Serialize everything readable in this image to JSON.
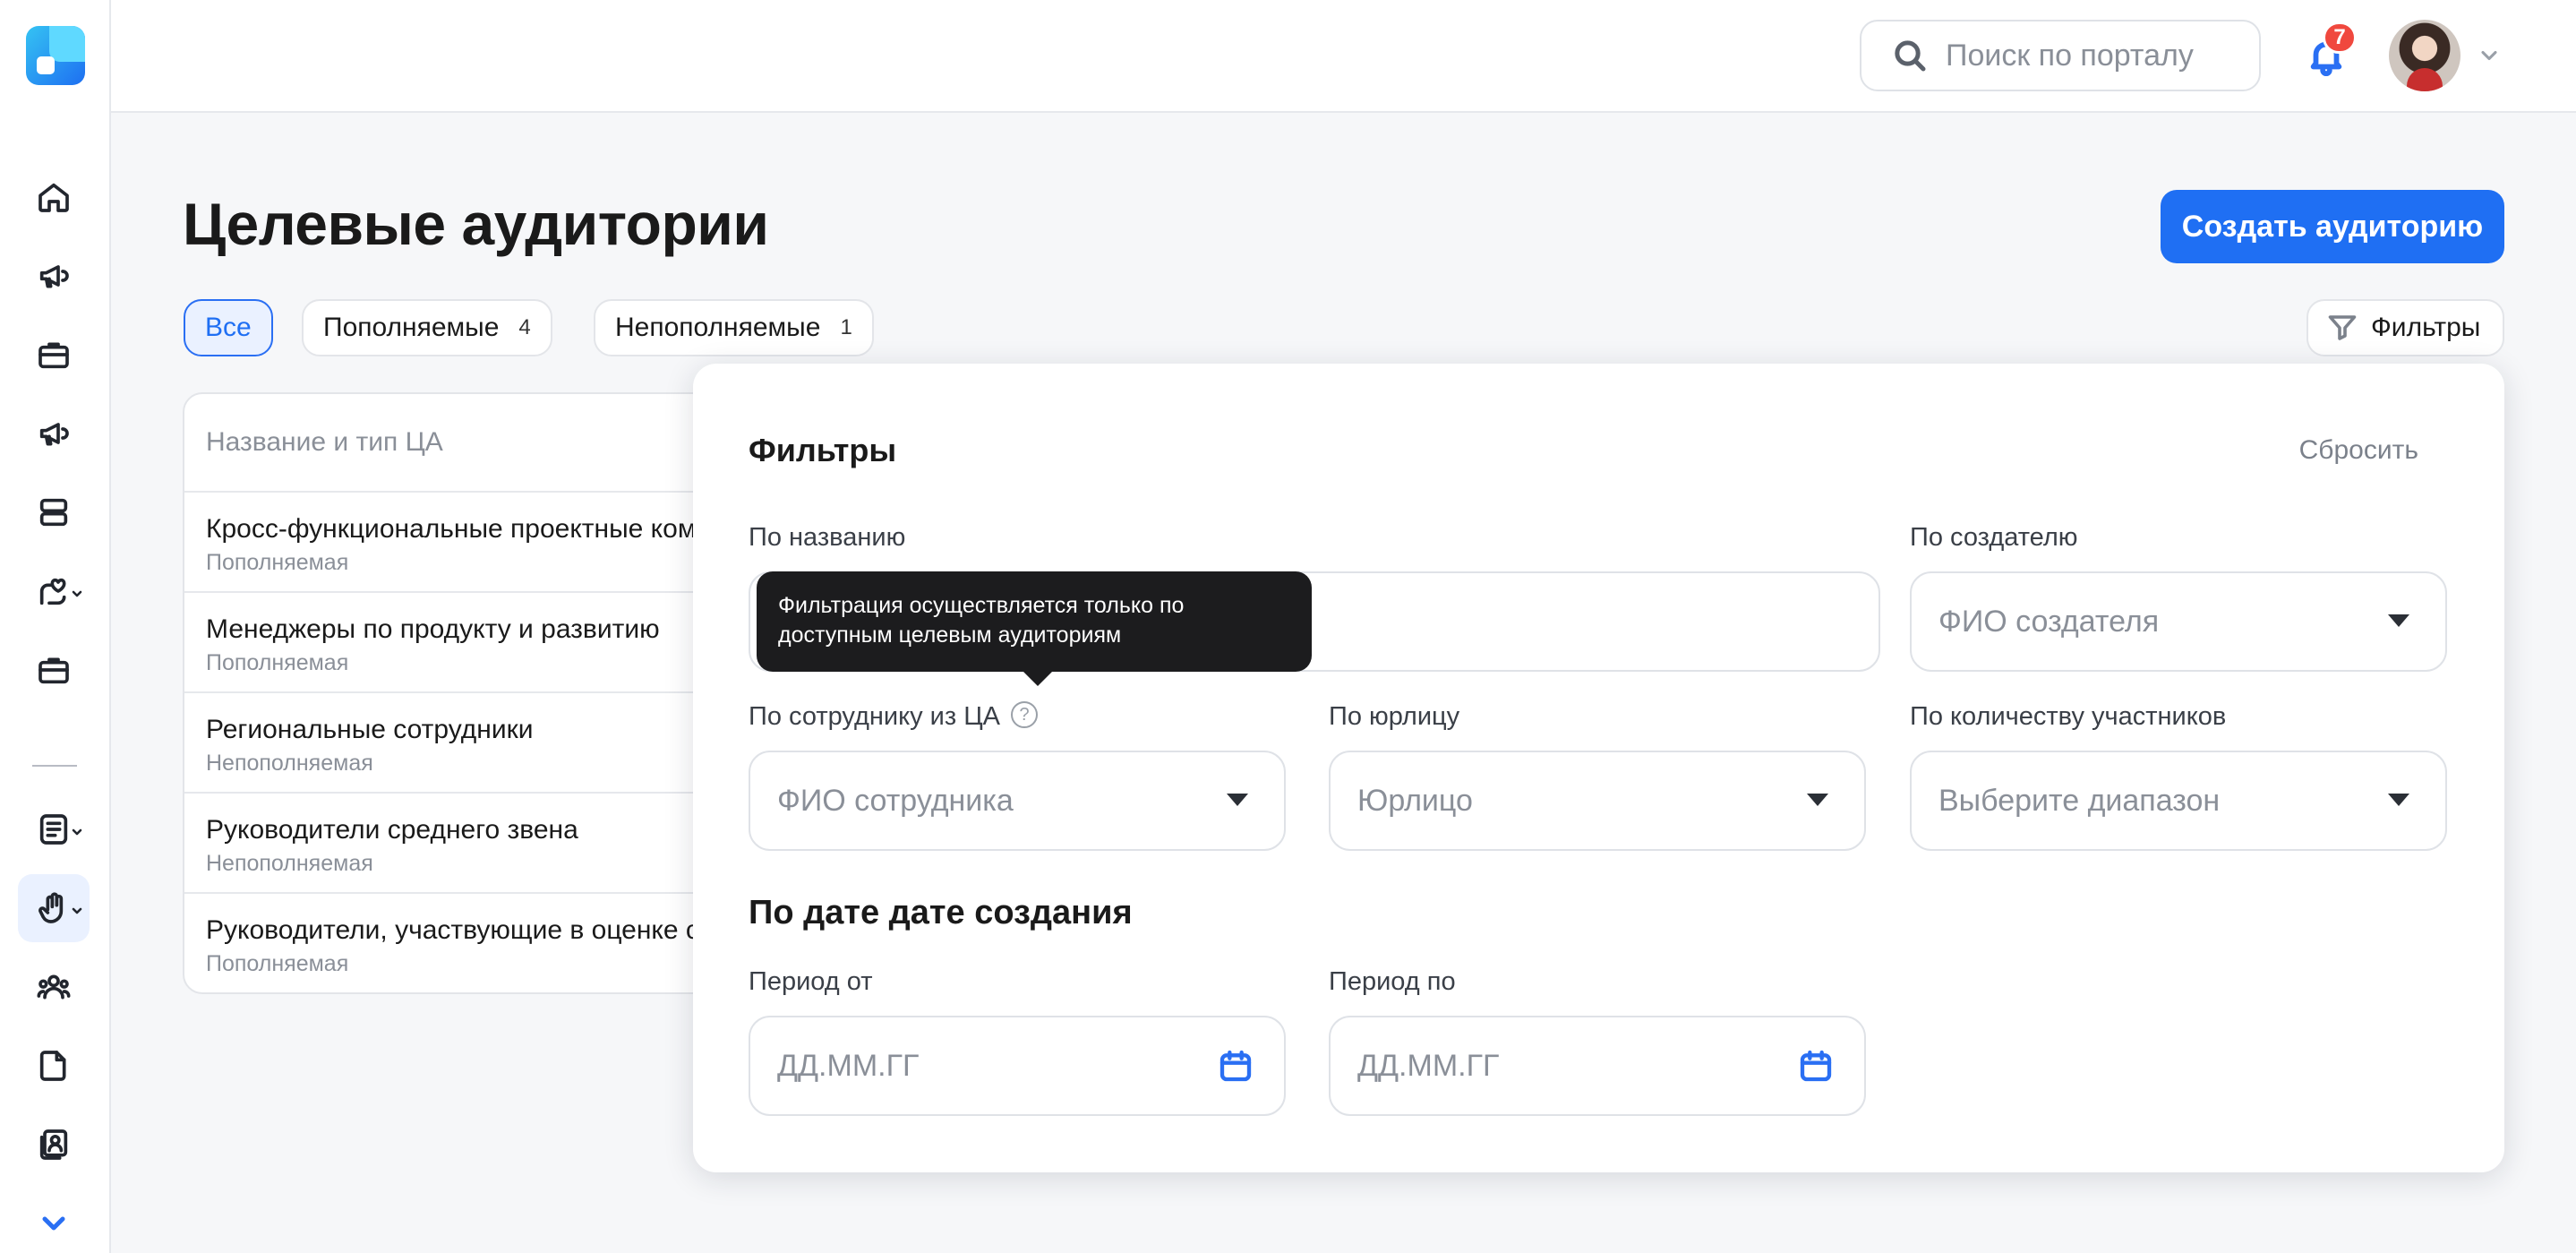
{
  "header": {
    "search_placeholder": "Поиск по порталу",
    "notification_count": "7"
  },
  "sidebar": {
    "items": [
      {
        "icon": "home-icon"
      },
      {
        "icon": "megaphone-icon"
      },
      {
        "icon": "briefcase-icon"
      },
      {
        "icon": "megaphone-icon"
      },
      {
        "icon": "server-icon"
      },
      {
        "icon": "hand-heart-icon"
      },
      {
        "icon": "briefcase-icon"
      },
      {
        "icon": "document-icon"
      },
      {
        "icon": "hand-wave-icon",
        "active": true
      },
      {
        "icon": "users-icon"
      },
      {
        "icon": "file-icon"
      },
      {
        "icon": "contacts-icon"
      }
    ],
    "accent": "#2A6FF3"
  },
  "page": {
    "title": "Целевые аудитории",
    "create_button": "Создать аудиторию",
    "filters_button": "Фильтры",
    "tabs": [
      {
        "label": "Все",
        "active": true
      },
      {
        "label": "Пополняемые",
        "count": "4"
      },
      {
        "label": "Непополняемые",
        "count": "1"
      }
    ]
  },
  "table": {
    "header": "Название и тип ЦА",
    "rows": [
      {
        "name": "Кросс-функциональные проектные ком",
        "type": "Пополняемая"
      },
      {
        "name": "Менеджеры по продукту и развитию",
        "type": "Пополняемая"
      },
      {
        "name": "Региональные сотрудники",
        "type": "Непополняемая"
      },
      {
        "name": "Руководители среднего звена",
        "type": "Непополняемая"
      },
      {
        "name": "Руководители, участвующие в оценке с",
        "type": "Пополняемая"
      }
    ]
  },
  "filters": {
    "title": "Фильтры",
    "reset": "Сбросить",
    "by_name": {
      "label": "По названию",
      "value": ""
    },
    "by_creator": {
      "label": "По создателю",
      "placeholder": "ФИО создателя"
    },
    "by_employee": {
      "label": "По сотруднику из ЦА",
      "placeholder": "ФИО сотрудника"
    },
    "by_entity": {
      "label": "По юрлицу",
      "placeholder": "Юрлицо"
    },
    "by_count": {
      "label": "По количеству участников",
      "placeholder": "Выберите диапазон"
    },
    "date_section": "По дате дате создания",
    "period_from": {
      "label": "Период от",
      "placeholder": "ДД.ММ.ГГ"
    },
    "period_to": {
      "label": "Период по",
      "placeholder": "ДД.ММ.ГГ"
    },
    "tooltip": {
      "line1": "Фильтрация осуществляется только по",
      "line2": "доступным целевым аудиториям"
    }
  },
  "colors": {
    "primary": "#1F6FF3",
    "badge": "#F0483E",
    "tooltip_bg": "#1C1C1E"
  }
}
